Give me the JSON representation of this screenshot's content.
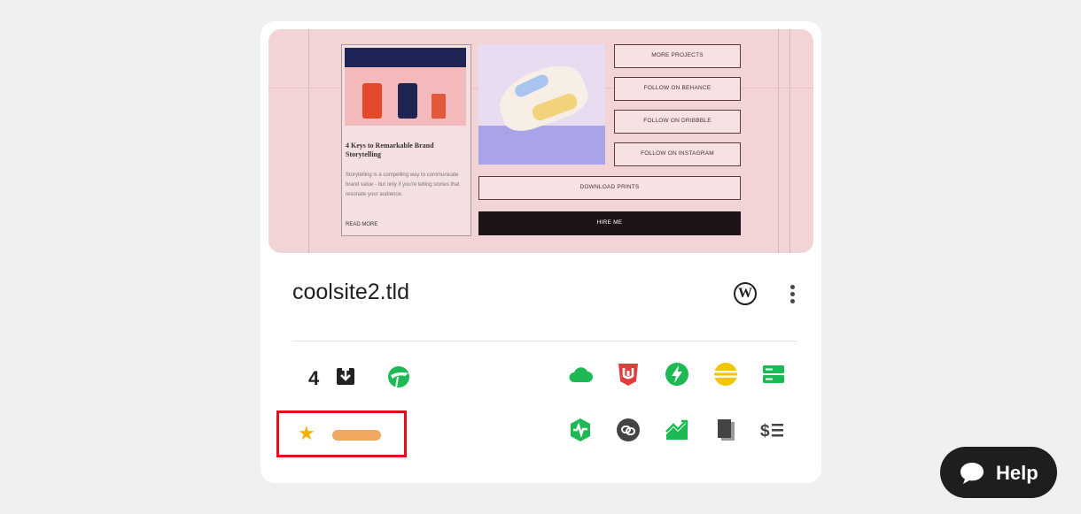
{
  "thumbnail": {
    "blog": {
      "title": "4 Keys to Remarkable Brand Storytelling",
      "text": "Storytelling is a compelling way to communicate brand value - but only if you're telling stories that resonate your audience.",
      "read_more": "READ MORE"
    },
    "buttons": [
      "MORE PROJECTS",
      "FOLLOW ON BEHANCE",
      "FOLLOW ON DRIBBBLE",
      "FOLLOW ON INSTAGRAM",
      "DOWNLOAD PRINTS",
      "HIRE ME"
    ]
  },
  "site": {
    "domain": "coolsite2.tld",
    "backups_count": "4"
  },
  "icons": {
    "wordpress": "wordpress-icon",
    "menu": "kebab-menu-icon",
    "backup": "download-box-icon",
    "row1": [
      "cloud-icon",
      "shield-html-icon",
      "bolt-icon",
      "database-icon",
      "server-icon"
    ],
    "row2": [
      "activity-monitor-icon",
      "link-icon",
      "chart-icon",
      "pages-icon",
      "billing-icon"
    ]
  },
  "colors": {
    "green": "#1db954",
    "red": "#e43c3c",
    "yellow": "#f5c400",
    "star": "#f0b400",
    "pill": "#f0a860",
    "highlight": "#e0101e"
  },
  "help": {
    "label": "Help"
  }
}
